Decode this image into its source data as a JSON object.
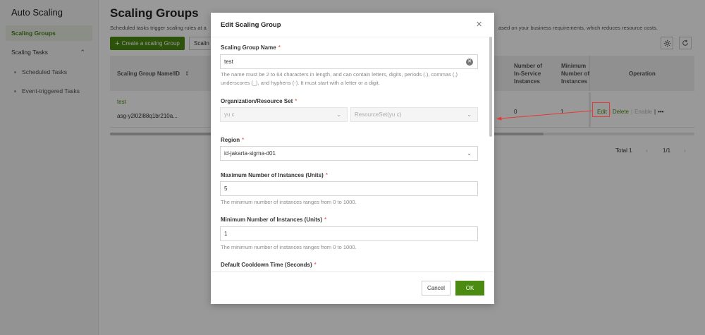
{
  "sidebar": {
    "app_title": "Auto Scaling",
    "items": [
      {
        "label": "Scaling Groups"
      },
      {
        "label": "Scaling Tasks"
      }
    ],
    "sub_items": [
      {
        "label": "Scheduled Tasks"
      },
      {
        "label": "Event-triggered Tasks"
      }
    ]
  },
  "main": {
    "title": "Scaling Groups",
    "description_left": "Scheduled tasks trigger scaling rules at a",
    "description_right": "ased on your business requirements, which reduces resource costs.",
    "create_button": "Create a scaling Group",
    "scaling_button": "Scalin",
    "table": {
      "headers": {
        "name_id": "Scaling Group Name/ID",
        "in_service": [
          "Number of",
          "In-Service",
          "Instances"
        ],
        "minimum": [
          "Minimum",
          "Number of",
          "Instances"
        ],
        "operation": "Operation"
      },
      "row": {
        "name": "test",
        "id": "asg-y2l02l88q1br210a...",
        "in_service": "0",
        "minimum": "1",
        "actions": {
          "edit": "Edit",
          "delete": "Delete",
          "enable": "Enable",
          "more": "•••"
        }
      }
    },
    "pager": {
      "total": "Total 1",
      "pages": "1/1"
    }
  },
  "modal": {
    "title": "Edit Scaling Group",
    "fields": {
      "name": {
        "label": "Scaling Group Name",
        "value": "test",
        "hint_1": "The name must be 2 to 64 characters in length, and can contain letters, digits, periods (.), commas (,)",
        "hint_2": "underscores (_), and hyphens (-). It must start with a letter or a digit."
      },
      "org": {
        "label": "Organization/Resource Set",
        "org_value": "yu c",
        "resource_value": "ResourceSet(yu c)"
      },
      "region": {
        "label": "Region",
        "value": "id-jakarta-sigma-d01"
      },
      "max": {
        "label": "Maximum Number of Instances (Units)",
        "value": "5",
        "hint": "The minimum number of instances ranges from 0 to 1000."
      },
      "min": {
        "label": "Minimum Number of Instances (Units)",
        "value": "1",
        "hint": "The minimum number of instances ranges from 0 to 1000."
      },
      "cooldown": {
        "label": "Default Cooldown Time (Seconds)"
      }
    },
    "required_mark": "*",
    "cancel": "Cancel",
    "ok": "OK"
  },
  "colors": {
    "accent": "#4c8b12",
    "required": "#e53935",
    "annotation": "#e53935"
  }
}
